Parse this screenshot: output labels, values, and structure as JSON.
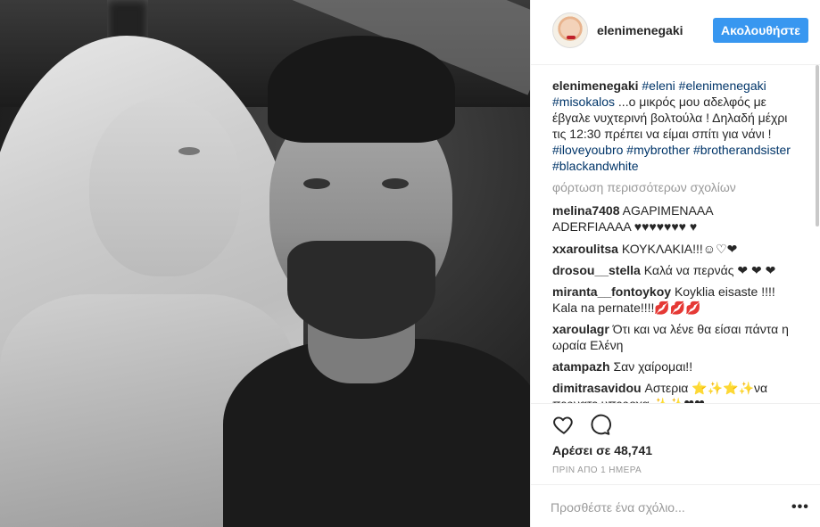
{
  "header": {
    "username": "elenimenegaki",
    "follow_label": "Ακολουθήστε"
  },
  "caption": {
    "username": "elenimenegaki",
    "tag1": "#eleni",
    "tag2": "#elenimenegaki",
    "tag3": "#misokalos",
    "text": " ...ο μικρός μου αδελφός με έβγαλε νυχτερινή βολτούλα ! Δηλαδή μέχρι τις 12:30 πρέπει να είμαι σπίτι για νάνι ! ",
    "tag4": "#iloveyoubro",
    "tag5": "#mybrother",
    "tag6": "#brotherandsister",
    "tag7": "#blackandwhite"
  },
  "load_more_label": "φόρτωση περισσότερων σχολίων",
  "comments": [
    {
      "user": "melina7408",
      "text": "AGAPIMENAAA ADERFIAAAA ♥♥♥♥♥♥♥ ♥"
    },
    {
      "user": "xxaroulitsa",
      "text": "ΚΟΥΚΛΑΚΙΑ!!!☺♡❤"
    },
    {
      "user": "drosou__stella",
      "text": "Καλά να περνάς ❤ ❤ ❤"
    },
    {
      "user": "miranta__fontoykoy",
      "text": "Koyklia eisaste !!!! Kala na pernate!!!!💋💋💋"
    },
    {
      "user": "xaroulagr",
      "text": "Ότι και να λένε θα είσαι πάντα η ωραία Ελένη"
    },
    {
      "user": "atampazh",
      "text": "Σαν χαίρομαι!!"
    },
    {
      "user": "dimitrasavidou",
      "text": "Αστερια ⭐✨⭐✨να περνατε υπεροχα ✨✨❤❤"
    }
  ],
  "likes_label": "Αρέσει σε 48,741",
  "likes_count": 48741,
  "time_label": "ΠΡΙΝ ΑΠΟ 1 ΗΜΕΡΑ",
  "comment_placeholder": "Προσθέστε ένα σχόλιο...",
  "more_options": "•••",
  "icons": {
    "like": "heart-icon",
    "comment": "comment-bubble-icon",
    "options": "more-options-icon"
  },
  "colors": {
    "accent": "#3897f0",
    "hashtag": "#003569",
    "muted": "#999999"
  }
}
